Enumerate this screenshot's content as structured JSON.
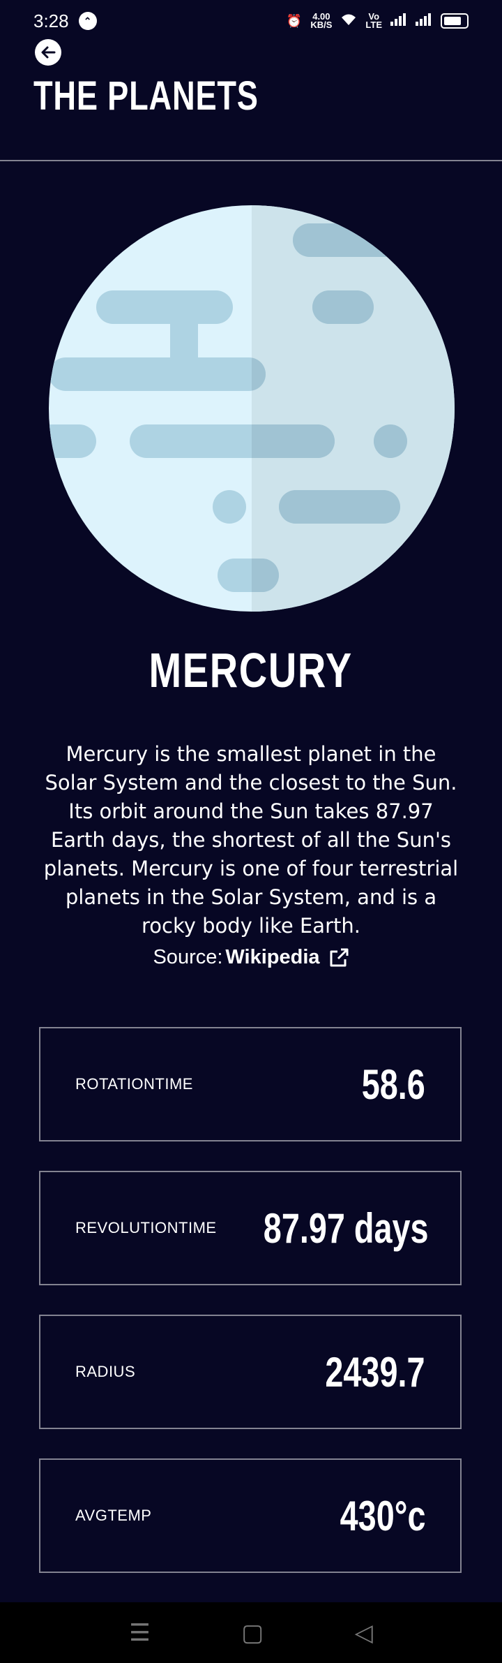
{
  "status": {
    "time": "3:28",
    "net_speed_value": "4.00",
    "net_speed_unit": "KB/S",
    "carrier_tag_top": "Vo",
    "carrier_tag_bottom": "LTE"
  },
  "header": {
    "title": "THE PLANETS"
  },
  "planet": {
    "name": "MERCURY",
    "description": "Mercury is the smallest planet in the Solar System and the closest to the Sun. Its orbit around the Sun takes 87.97 Earth days, the shortest of all the Sun's planets. Mercury is one of four terrestrial planets in the Solar System, and is a rocky body like Earth.",
    "source_prefix": "Source:",
    "source_link": "Wikipedia",
    "colors": {
      "light": "#DDF3FC",
      "shade": "#CDE3EB",
      "crater": "#AED3E3",
      "crater_shade": "#A0C3D3"
    }
  },
  "stats": [
    {
      "label": "ROTATIONTIME",
      "value": "58.6"
    },
    {
      "label": "REVOLUTIONTIME",
      "value": "87.97 days"
    },
    {
      "label": "RADIUS",
      "value": "2439.7"
    },
    {
      "label": "AVGTEMP",
      "value": "430°c"
    }
  ],
  "nav": {
    "menu": "☰",
    "home": "▢",
    "back": "◁"
  }
}
